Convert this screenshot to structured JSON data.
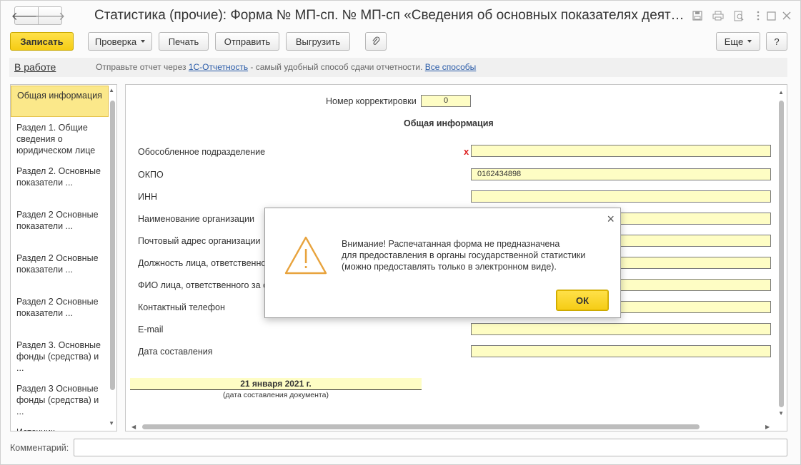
{
  "window": {
    "title": "Статистика (прочие): Форма № МП-сп. № МП-сп «Сведения об основных показателях деятельности малого предприятия»"
  },
  "nav": {
    "back": "🡐",
    "forward": "🡒"
  },
  "title_icons": [
    "save-icon",
    "print-icon",
    "preview-icon",
    "more-vert-icon",
    "maximize-icon",
    "close-icon"
  ],
  "toolbar": {
    "save": "Записать",
    "check": "Проверка",
    "print": "Печать",
    "send": "Отправить",
    "export": "Выгрузить",
    "more": "Еще",
    "help": "?"
  },
  "infobar": {
    "status": "В работе",
    "text_before": "Отправьте отчет через ",
    "link1": "1С-Отчетность",
    "text_middle": " - самый удобный способ сдачи отчетности. ",
    "link2": "Все способы"
  },
  "sidebar": {
    "items": [
      {
        "label": "Общая информация"
      },
      {
        "label": "Раздел 1. Общие сведения о юридическом лице"
      },
      {
        "label": "Раздел 2. Основные показатели ..."
      },
      {
        "label": "Раздел 2 Основные показатели ..."
      },
      {
        "label": "Раздел 2 Основные показатели ..."
      },
      {
        "label": "Раздел 2 Основные показатели ..."
      },
      {
        "label": "Раздел 3. Основные фонды (средства) и ..."
      },
      {
        "label": "Раздел 3 Основные фонды (средства) и ..."
      },
      {
        "label": "Источник ..."
      }
    ]
  },
  "form": {
    "correction_label": "Номер корректировки",
    "correction_value": "0",
    "heading": "Общая информация",
    "fields": [
      {
        "label": "Обособленное подразделение",
        "value": "",
        "required": "x"
      },
      {
        "label": "ОКПО",
        "value": "0162434898"
      },
      {
        "label": "ИНН",
        "value": ""
      },
      {
        "label": "Наименование организации",
        "value": ""
      },
      {
        "label": "Почтовый адрес организации",
        "value": ""
      },
      {
        "label": "Должность лица, ответственного",
        "value": ""
      },
      {
        "label": "ФИО лица, ответственного за со",
        "value": ""
      },
      {
        "label": "Контактный телефон",
        "value": ""
      },
      {
        "label": "E-mail",
        "value": ""
      },
      {
        "label": "Дата составления",
        "value": ""
      }
    ],
    "date_value": "21 января 2021 г.",
    "date_caption": "(дата составления документа)"
  },
  "dialog": {
    "line1": "Внимание! Распечатанная форма не предназначена",
    "line2": "для предоставления в органы государственной статистики",
    "line3": "(можно предоставлять только в электронном виде).",
    "ok": "ОК",
    "close": "×"
  },
  "comment": {
    "label": "Комментарий:",
    "value": ""
  },
  "colors": {
    "accent": "#f5cc14",
    "field_bg": "#fefdc4",
    "active_item": "#fbe88a",
    "link": "#2a5ba8",
    "required": "#dd2222",
    "warning": "#e8a33d"
  }
}
